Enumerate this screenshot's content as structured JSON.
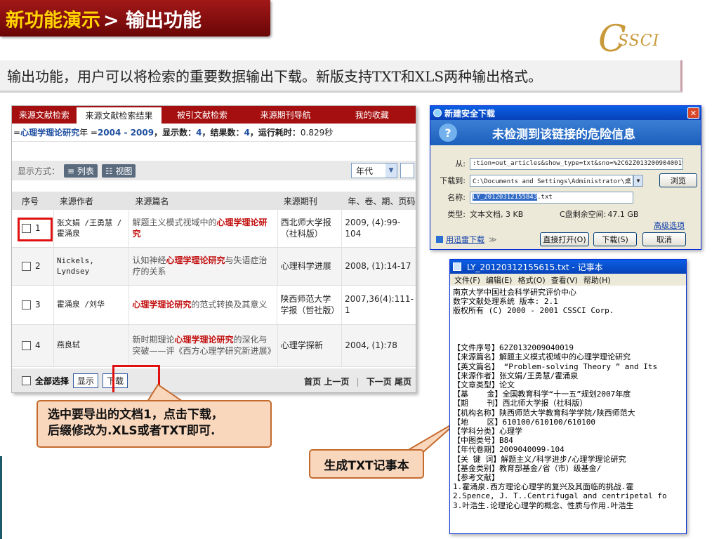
{
  "slide": {
    "title_main": "新功能演示",
    "title_sub": "> 输出功能",
    "logo_text": "SSCI",
    "logo_letter": "C",
    "description": "输出功能，用户可以将检索的重要数据输出下载。新版支持TXT和XLS两种输出格式。"
  },
  "search_panel": {
    "tabs": [
      "来源文献检索",
      "来源文献检索结果",
      "被引文献检索",
      "来源期刊导航",
      "我的收藏"
    ],
    "active_tab": 1,
    "query": {
      "prefix": "= ",
      "field": "心理学理论研究",
      "year_part": " 年 = ",
      "year_range": "2004 - 2009",
      "sep1": "，",
      "shown_label": "显示数：",
      "shown_value": "4",
      "sep2": "，",
      "result_label": "结果数：",
      "result_value": "4",
      "sep3": "，",
      "time_label": "运行耗时：",
      "time_value": "0.829秒"
    },
    "display_label": "显示方式：",
    "mode_list": "≡ 列表",
    "mode_view": "☷ 视图",
    "year_select": "年代",
    "columns": [
      "序号",
      "来源作者",
      "来源篇名",
      "来源期刊",
      "年、卷、期、页码"
    ],
    "rows": [
      {
        "num": "1",
        "author": "张文娟 /王勇慧 /霍涌泉",
        "title_pre": "解题主义模式视域中的",
        "title_hl": "心理学理论研究",
        "title_post": "",
        "source": "西北师大学报（社科版）",
        "year": "2009, (4):99-104"
      },
      {
        "num": "2",
        "author": "Nickels, Lyndsey",
        "title_pre": "认知神经",
        "title_hl": "心理学理论研究",
        "title_post": "与失语症治疗的关系",
        "source": "心理科学进展",
        "year": "2008, (1):14-17"
      },
      {
        "num": "3",
        "author": "霍涌泉 /刘华",
        "title_pre": "",
        "title_hl": "心理学理论研究",
        "title_post": "的范式转换及其意义",
        "source": "陕西师范大学学报（哲社版）",
        "year": "2007,36(4):111-1"
      },
      {
        "num": "4",
        "author": "燕良轼",
        "title_pre": "新时期理论",
        "title_hl": "心理学理论研究",
        "title_post": "的深化与突破——评《西方心理学研究新进展》",
        "source": "心理学探新",
        "year": "2004, (1):78"
      }
    ],
    "select_all": "全部选择",
    "show_button": "显示",
    "download_button": "下载",
    "pager": {
      "first": "首页",
      "prev": "上一页",
      "sep": "|",
      "next": "下一页",
      "last": "尾页"
    }
  },
  "callouts": {
    "export_tip_line1": "选中要导出的文档1，点击下载，",
    "export_tip_line2": "后缀修改为.XLS或者TXT即可.",
    "txt_tip": "生成TXT记事本"
  },
  "download_dialog": {
    "title": "新建安全下载",
    "close": "✕",
    "message": "未检测到该链接的危险信息",
    "from_label": "从:",
    "from_value": ":tion=out_articles&show_type=txt&sno=%2C62Z0132009040019%2C",
    "to_label": "下载到:",
    "to_value": "C:\\Documents and Settings\\Administrator\\桌",
    "browse": "浏览",
    "name_label": "名称:",
    "name_highlight": "LY_20120312155843",
    "name_ext": ".txt",
    "type_label": "类型:",
    "type_value": "文本文档, 3 KB",
    "disk_label": "C盘剩余空间:",
    "disk_value": "47.1 GB",
    "advanced": "高级选项",
    "thunder": "用迅雷下载",
    "thunder_arrow": "≫",
    "open": "直接打开(O)",
    "download": "下载(S)",
    "cancel": "取消"
  },
  "notepad": {
    "title": "LY_20120312155615.txt - 记事本",
    "menu": [
      "文件(F)",
      "编辑(E)",
      "格式(O)",
      "查看(V)",
      "帮助(H)"
    ],
    "lines": [
      "南京大学中国社会科学研究评价中心",
      "数字文献处理系统 版本: 2.1",
      "版权所有 (C) 2000 - 2001 CSSCI Corp.",
      "",
      "",
      "",
      "【文件序号】62Z0132009040019",
      "【来源篇名】解题主义模式视域中的心理学理论研究",
      "【英文篇名】 “Problem-solving Theory ” and Its",
      "【来源作者】张文娟/王勇慧/霍涌泉",
      "【文章类型】论文",
      "【基    金】全国教育科学“十一五”规划2007年度",
      "【期    刊】西北师大学报（社科版）",
      "【机构名称】陕西师范大学教育科学学院/陕西师范大",
      "【地    区】610100/610100/610100",
      "【学科分类】心理学",
      "【中图类号】B84",
      "【年代卷期】2009040099-104",
      "【关 键 词】解题主义/科学进步/心理学理论研究",
      "【基金类别】教育部基金/省（市）级基金/",
      "【参考文献】",
      "1.霍涌泉.西方理论心理学的复兴及其面临的挑战.霍",
      "2.Spence, J. T..Centrifugal and centripetal fo",
      "3.叶浩生.论理论心理学的概念、性质与作用.叶浩生"
    ]
  }
}
